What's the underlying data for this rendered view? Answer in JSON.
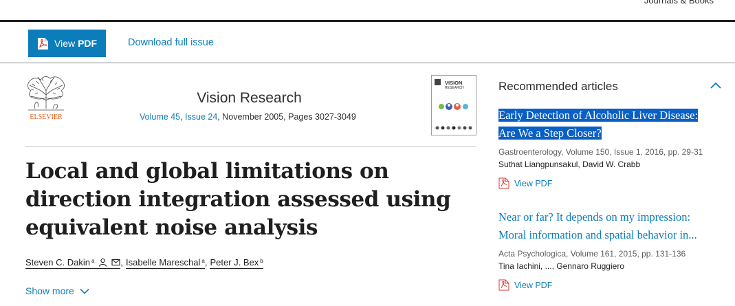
{
  "header": {
    "journals_link": "Journals & Books"
  },
  "toolbar": {
    "view_pdf_prefix": "View",
    "view_pdf_strong": "PDF",
    "download_label": "Download full issue"
  },
  "journal": {
    "name": "Vision Research",
    "volume": "Volume 45",
    "issue": "Issue 24",
    "date_pages": ", November 2005, Pages 3027-3049",
    "publisher": "ELSEVIER",
    "cover_label": "VISION",
    "cover_sub": "RESEARCH"
  },
  "article": {
    "title": "Local and global limitations on direction integration assessed using equivalent noise analysis",
    "authors": [
      {
        "name": "Steven C. Dakin",
        "sup": "a"
      },
      {
        "name": "Isabelle Mareschal",
        "sup": "a"
      },
      {
        "name": "Peter J. Bex",
        "sup": "b"
      }
    ],
    "separator": ",",
    "show_more": "Show more"
  },
  "recommended": {
    "heading": "Recommended articles",
    "items": [
      {
        "title_line1": "Early Detection of Alcoholic Liver Disease:",
        "title_line2": "Are We a Step Closer?",
        "source": "Gastroenterology, Volume 150, Issue 1, 2016, pp. 29-31",
        "authors": "Suthat Liangpunsakul, David W. Crabb",
        "pdf_label": "View PDF"
      },
      {
        "title_line1": "Near or far? It depends on my impression:",
        "title_line2": "Moral information and spatial behavior in...",
        "source": "Acta Psychologica, Volume 161, 2015, pp. 131-136",
        "authors": "Tina Iachini, ..., Gennaro Ruggiero",
        "pdf_label": "View PDF"
      }
    ]
  },
  "colors": {
    "link": "#0c7dbb",
    "button": "#0c7dbb",
    "selection": "#0a5fc5",
    "pdf_icon": "#d9372b"
  },
  "icons": [
    "pdf-icon",
    "person-icon",
    "envelope-icon",
    "chevron-down-icon",
    "chevron-up-icon",
    "elsevier-tree-logo"
  ]
}
